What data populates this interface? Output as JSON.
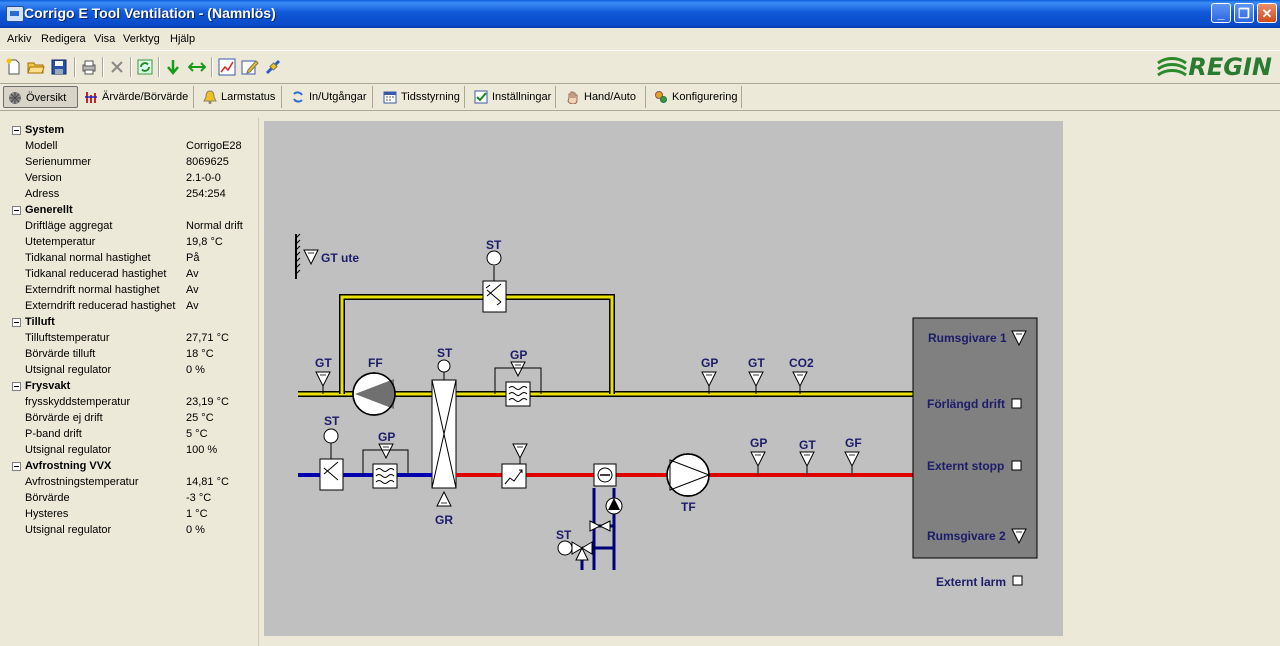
{
  "window": {
    "title": "Corrigo E Tool Ventilation - (Namnlös)",
    "minimize": "_",
    "restore": "❐",
    "close": "✕"
  },
  "menu": [
    "Arkiv",
    "Redigera",
    "Visa",
    "Verktyg",
    "Hjälp"
  ],
  "toolbar": {
    "icons": [
      "new-icon",
      "open-icon",
      "save-icon",
      "print-icon",
      "delete-icon",
      "refresh-icon",
      "download-icon",
      "transfer-icon",
      "chart-icon",
      "edit-icon",
      "connect-icon"
    ],
    "logo": "REGIN"
  },
  "tabs": [
    {
      "label": "Översikt",
      "icon": "overview-icon",
      "active": true
    },
    {
      "label": "Ärvärde/Börvärde",
      "icon": "setpoint-icon"
    },
    {
      "label": "Larmstatus",
      "icon": "alarm-icon"
    },
    {
      "label": "In/Utgångar",
      "icon": "io-icon"
    },
    {
      "label": "Tidsstyrning",
      "icon": "schedule-icon"
    },
    {
      "label": "Inställningar",
      "icon": "settings-icon"
    },
    {
      "label": "Hand/Auto",
      "icon": "hand-icon"
    },
    {
      "label": "Konfigurering",
      "icon": "config-icon"
    }
  ],
  "tree": {
    "system": {
      "title": "System",
      "rows": [
        [
          "Modell",
          "CorrigoE28"
        ],
        [
          "Serienummer",
          "8069625"
        ],
        [
          "Version",
          "2.1-0-0"
        ],
        [
          "Adress",
          "254:254"
        ]
      ]
    },
    "generellt": {
      "title": "Generellt",
      "rows": [
        [
          "Driftläge aggregat",
          "Normal drift"
        ],
        [
          "Utetemperatur",
          "19,8 °C"
        ],
        [
          "Tidkanal normal hastighet",
          "På"
        ],
        [
          "Tidkanal reducerad hastighet",
          "Av"
        ],
        [
          "Externdrift normal hastighet",
          "Av"
        ],
        [
          "Externdrift reducerad hastighet",
          "Av"
        ]
      ]
    },
    "tilluft": {
      "title": "Tilluft",
      "rows": [
        [
          "Tilluftstemperatur",
          "27,71 °C"
        ],
        [
          "Börvärde tilluft",
          "18 °C"
        ],
        [
          "Utsignal regulator",
          "0 %"
        ]
      ]
    },
    "frysvakt": {
      "title": "Frysvakt",
      "rows": [
        [
          "frysskyddstemperatur",
          "23,19 °C"
        ],
        [
          "Börvärde ej drift",
          "25 °C"
        ],
        [
          "P-band drift",
          "5 °C"
        ],
        [
          "Utsignal regulator",
          "100 %"
        ]
      ]
    },
    "avfrostning": {
      "title": "Avfrostning VVX",
      "rows": [
        [
          "Avfrostningstemperatur",
          "14,81 °C"
        ],
        [
          "Börvärde",
          "-3 °C"
        ],
        [
          "Hysteres",
          "1 °C"
        ],
        [
          "Utsignal regulator",
          "0 %"
        ]
      ]
    }
  },
  "diagram": {
    "labels": {
      "gt_ute": "GT ute",
      "st_top": "ST",
      "gt_supply": "GT",
      "ff": "FF",
      "st_hx": "ST",
      "gp_supply": "GP",
      "gp_room": "GP",
      "gt_room": "GT",
      "co2": "CO2",
      "st_exhaust": "ST",
      "gp_exhaust": "GP",
      "gr": "GR",
      "tf": "TF",
      "gp_exhaust2": "GP",
      "gt_exhaust": "GT",
      "gf": "GF",
      "st_valve": "ST"
    },
    "room_panel": {
      "sensor1": "Rumsgivare 1",
      "extended": "Förlängd drift",
      "ext_stop": "Externt stopp",
      "sensor2": "Rumsgivare 2"
    },
    "ext_alarm": "Externt larm",
    "colors": {
      "supply": "#e8e000",
      "exhaust_hot": "#e00000",
      "exhaust_cold": "#0000b0",
      "water": "#00007a",
      "panel": "#808080"
    }
  }
}
